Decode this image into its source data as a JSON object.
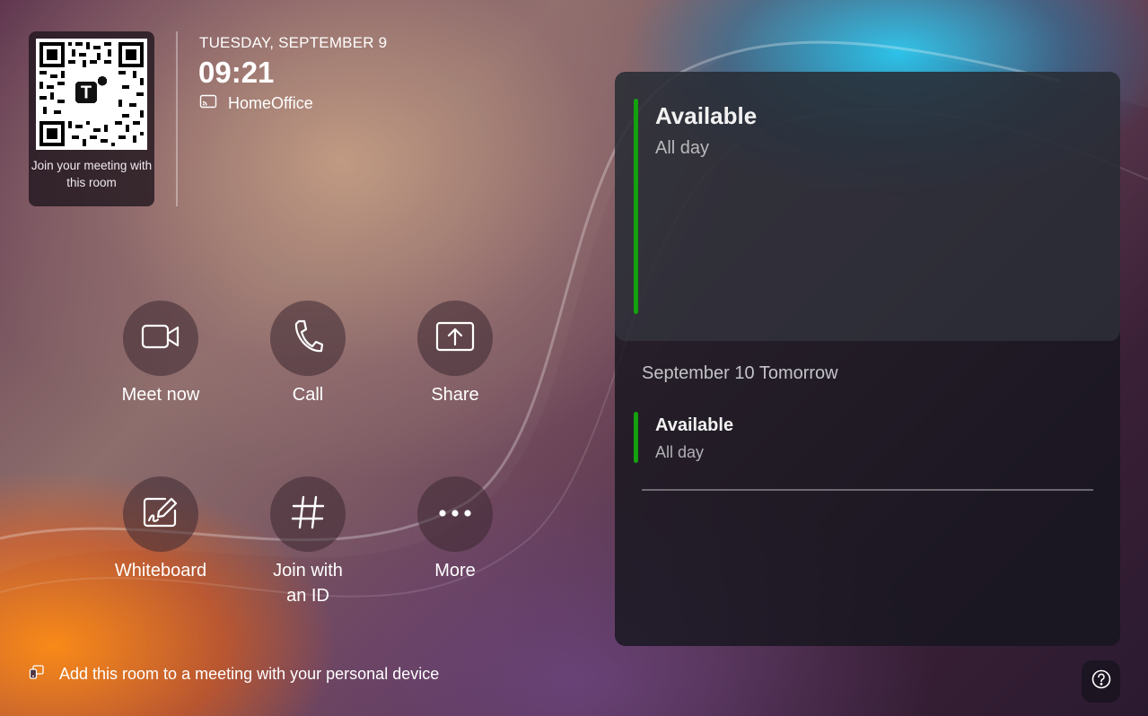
{
  "qr": {
    "caption": "Join your meeting with this room"
  },
  "header": {
    "date": "TUESDAY, SEPTEMBER 9",
    "time": "09:21",
    "room_name": "HomeOffice"
  },
  "actions": [
    {
      "label": "Meet now",
      "icon": "video-camera-icon"
    },
    {
      "label": "Call",
      "icon": "phone-icon"
    },
    {
      "label": "Share",
      "icon": "share-screen-icon"
    },
    {
      "label": "Whiteboard",
      "icon": "whiteboard-icon"
    },
    {
      "label": "Join with an ID",
      "icon": "hash-icon"
    },
    {
      "label": "More",
      "icon": "more-icon"
    }
  ],
  "hint": {
    "text": "Add this room to a meeting with your personal device",
    "icon": "personal-device-icon"
  },
  "help": {
    "icon": "help-icon"
  },
  "calendar": {
    "today": {
      "title": "Available",
      "subtitle": "All day"
    },
    "tomorrow_header": "September 10 Tomorrow",
    "tomorrow": {
      "title": "Available",
      "subtitle": "All day"
    }
  },
  "colors": {
    "available_bar": "#13a10e"
  }
}
